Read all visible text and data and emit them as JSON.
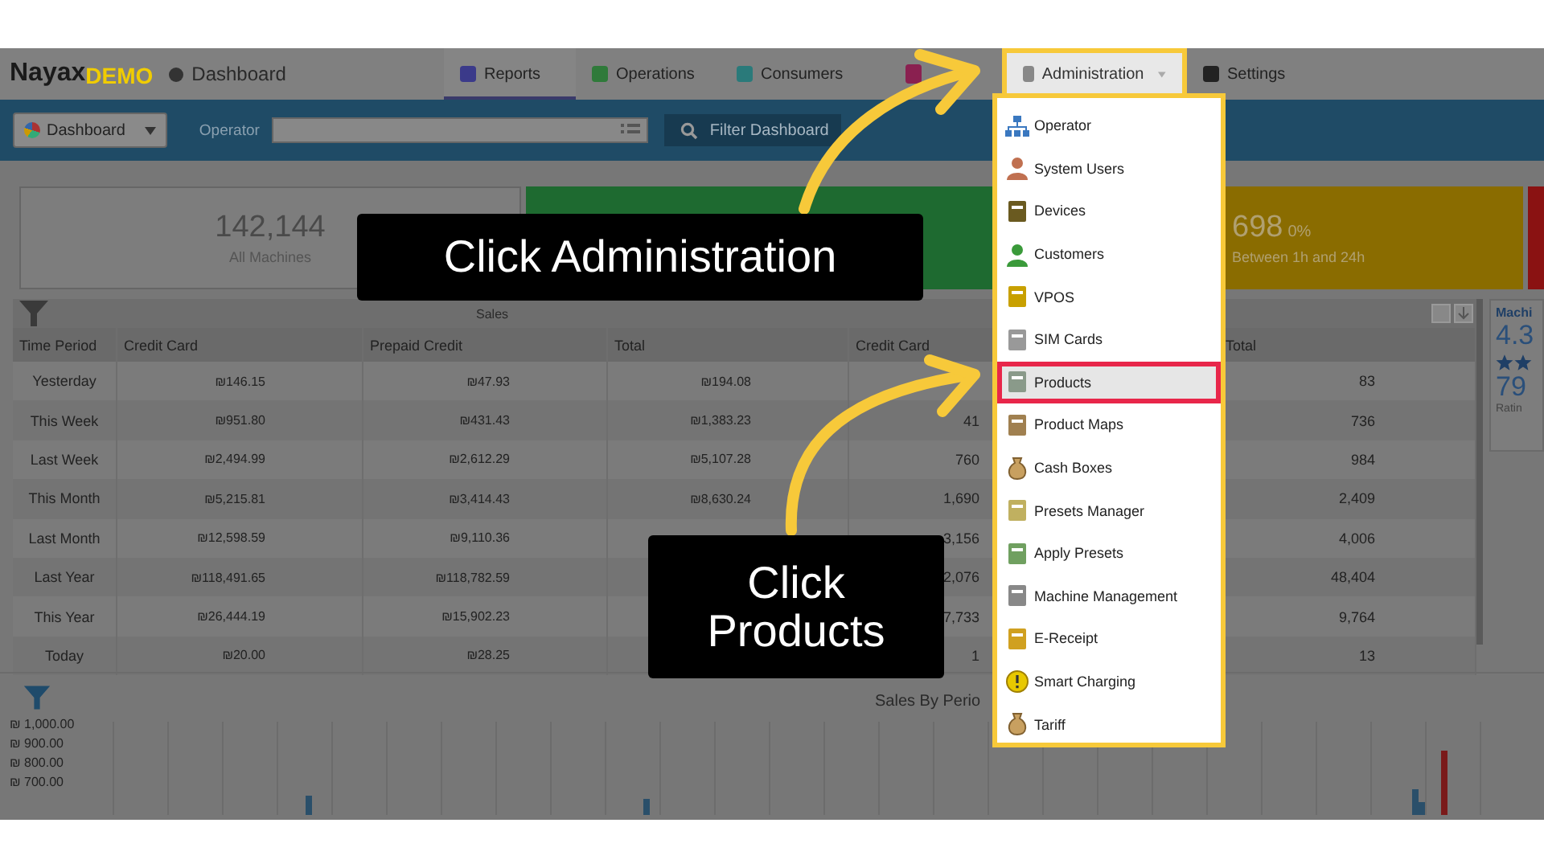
{
  "nav": {
    "logo_main": "Nayax",
    "logo_accent": "DEMO",
    "page": "Dashboard",
    "tabs": [
      {
        "label": "Reports",
        "selected": true,
        "expanded": false
      },
      {
        "label": "Operations",
        "selected": false,
        "expanded": false
      },
      {
        "label": "Consumers",
        "selected": false,
        "expanded": false
      },
      {
        "label": "Administration",
        "selected": false,
        "expanded": true
      },
      {
        "label": "Settings",
        "selected": false,
        "expanded": false
      }
    ]
  },
  "toolbar": {
    "view": "Dashboard",
    "operator_label": "Operator",
    "filter_button": "Filter Dashboard"
  },
  "stats": [
    {
      "value": "142,144",
      "label": "All Machines",
      "color": "#7d7d7d"
    },
    {
      "color": "#1e6a30"
    },
    {
      "value": "698",
      "percent": "0%",
      "label": "Between 1h and 24h",
      "color": "#8a6c00"
    },
    {
      "color": "#8a1212"
    }
  ],
  "table": {
    "group_header": "Sales",
    "columns": [
      "Time Period",
      "Credit Card",
      "Prepaid Credit",
      "Total",
      "Credit Card",
      null,
      "Total"
    ],
    "rows": [
      {
        "time_period": "Yesterday",
        "credit_card": "₪146.15",
        "prepaid_credit": "₪47.93",
        "total": "₪194.08",
        "count_total": "83"
      },
      {
        "time_period": "This Week",
        "credit_card": "₪951.80",
        "prepaid_credit": "₪431.43",
        "total": "₪1,383.23",
        "count_credit_card": "41",
        "count_total": "736"
      },
      {
        "time_period": "Last Week",
        "credit_card": "₪2,494.99",
        "prepaid_credit": "₪2,612.29",
        "total": "₪5,107.28",
        "count_credit_card": "760",
        "count_total": "984"
      },
      {
        "time_period": "This Month",
        "credit_card": "₪5,215.81",
        "prepaid_credit": "₪3,414.43",
        "total": "₪8,630.24",
        "count_credit_card": "1,690",
        "count_total": "2,409"
      },
      {
        "time_period": "Last Month",
        "credit_card": "₪12,598.59",
        "prepaid_credit": "₪9,110.36",
        "count_credit_card": "3,156",
        "count_total": "4,006"
      },
      {
        "time_period": "Last Year",
        "credit_card": "₪118,491.65",
        "prepaid_credit": "₪118,782.59",
        "count_credit_card": "2,076",
        "count_total": "48,404"
      },
      {
        "time_period": "This Year",
        "credit_card": "₪26,444.19",
        "prepaid_credit": "₪15,902.23",
        "count_credit_card": "7,733",
        "count_total": "9,764"
      },
      {
        "time_period": "Today",
        "credit_card": "₪20.00",
        "prepaid_credit": "₪28.25",
        "count_credit_card": "1",
        "count_total": "13"
      }
    ]
  },
  "side_panel": {
    "title": "Machi",
    "rating": "4.3",
    "count": "79",
    "caption": "Ratin"
  },
  "chart": {
    "title": "Sales By Perio",
    "y_ticks": [
      "₪ 1,000.00",
      "₪ 900.00",
      "₪ 800.00",
      "₪ 700.00"
    ]
  },
  "callouts": [
    {
      "text": "Click Administration"
    },
    {
      "text": "Click Products"
    }
  ],
  "menu": {
    "items": [
      {
        "label": "Operator",
        "selected": false
      },
      {
        "label": "System Users",
        "selected": false
      },
      {
        "label": "Devices",
        "selected": false
      },
      {
        "label": "Customers",
        "selected": false
      },
      {
        "label": "VPOS",
        "selected": false
      },
      {
        "label": "SIM Cards",
        "selected": false
      },
      {
        "label": "Products",
        "selected": true
      },
      {
        "label": "Product Maps",
        "selected": false
      },
      {
        "label": "Cash Boxes",
        "selected": false
      },
      {
        "label": "Presets Manager",
        "selected": false
      },
      {
        "label": "Apply Presets",
        "selected": false
      },
      {
        "label": "Machine Management",
        "selected": false
      },
      {
        "label": "E-Receipt",
        "selected": false
      },
      {
        "label": "Smart Charging",
        "selected": false
      },
      {
        "label": "Tariff",
        "selected": false
      }
    ]
  }
}
